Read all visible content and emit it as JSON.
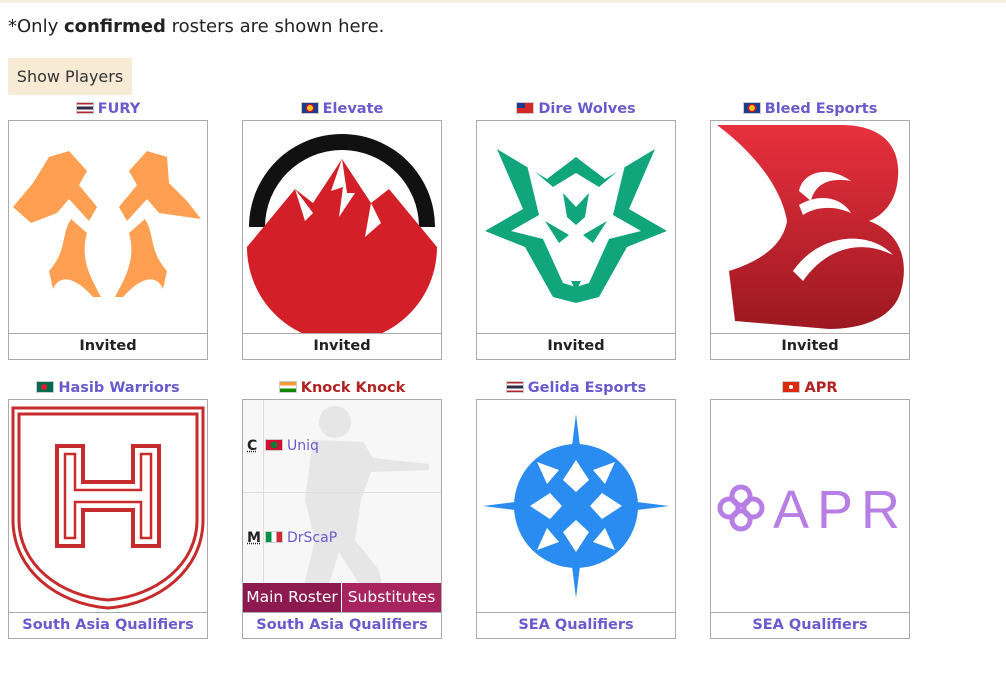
{
  "note": {
    "prefix": "*Only ",
    "bold": "confirmed",
    "suffix": " rosters are shown here."
  },
  "show_players_button": "Show Players",
  "teams": [
    {
      "name": "FURY",
      "flag": "thailand-flag",
      "status": "Invited",
      "logo": "crossed-axes-logo",
      "colors": {
        "primary": "#ff9f52"
      }
    },
    {
      "name": "Elevate",
      "flag": "asean-flag",
      "status": "Invited",
      "logo": "mountain-logo",
      "colors": {
        "primary": "#d32028",
        "secondary": "#111111"
      }
    },
    {
      "name": "Dire Wolves",
      "flag": "taiwan-flag",
      "status": "Invited",
      "logo": "wolf-logo",
      "colors": {
        "primary": "#11a57c"
      }
    },
    {
      "name": "Bleed Esports",
      "flag": "asean-flag",
      "status": "Invited",
      "logo": "letter-b-logo",
      "colors": {
        "primary": "#d0232f"
      }
    },
    {
      "name": "Hasib Warriors",
      "flag": "bangladesh-flag",
      "status": "South Asia Qualifiers",
      "logo": "h-shield-logo",
      "colors": {
        "primary": "#c72b2b"
      }
    },
    {
      "name": "Knock Knock",
      "flag": "india-flag",
      "status": "South Asia Qualifiers",
      "logo": "roster-card",
      "roster": [
        {
          "pos": "C",
          "flag": "maldives-flag",
          "player": "Uniq"
        },
        {
          "pos": "M",
          "flag": "italy-flag",
          "player": "DrScaP"
        }
      ],
      "tabs": [
        "Main Roster",
        "Substitutes"
      ]
    },
    {
      "name": "Gelida Esports",
      "flag": "thailand-flag",
      "status": "SEA Qualifiers",
      "logo": "star-snowflake-logo",
      "colors": {
        "primary": "#2a8cf0"
      }
    },
    {
      "name": "APR",
      "flag": "hong-kong-flag",
      "status": "SEA Qualifiers",
      "logo": "apr-logo",
      "colors": {
        "primary": "#b77ee6"
      },
      "logo_text": "APR"
    }
  ]
}
